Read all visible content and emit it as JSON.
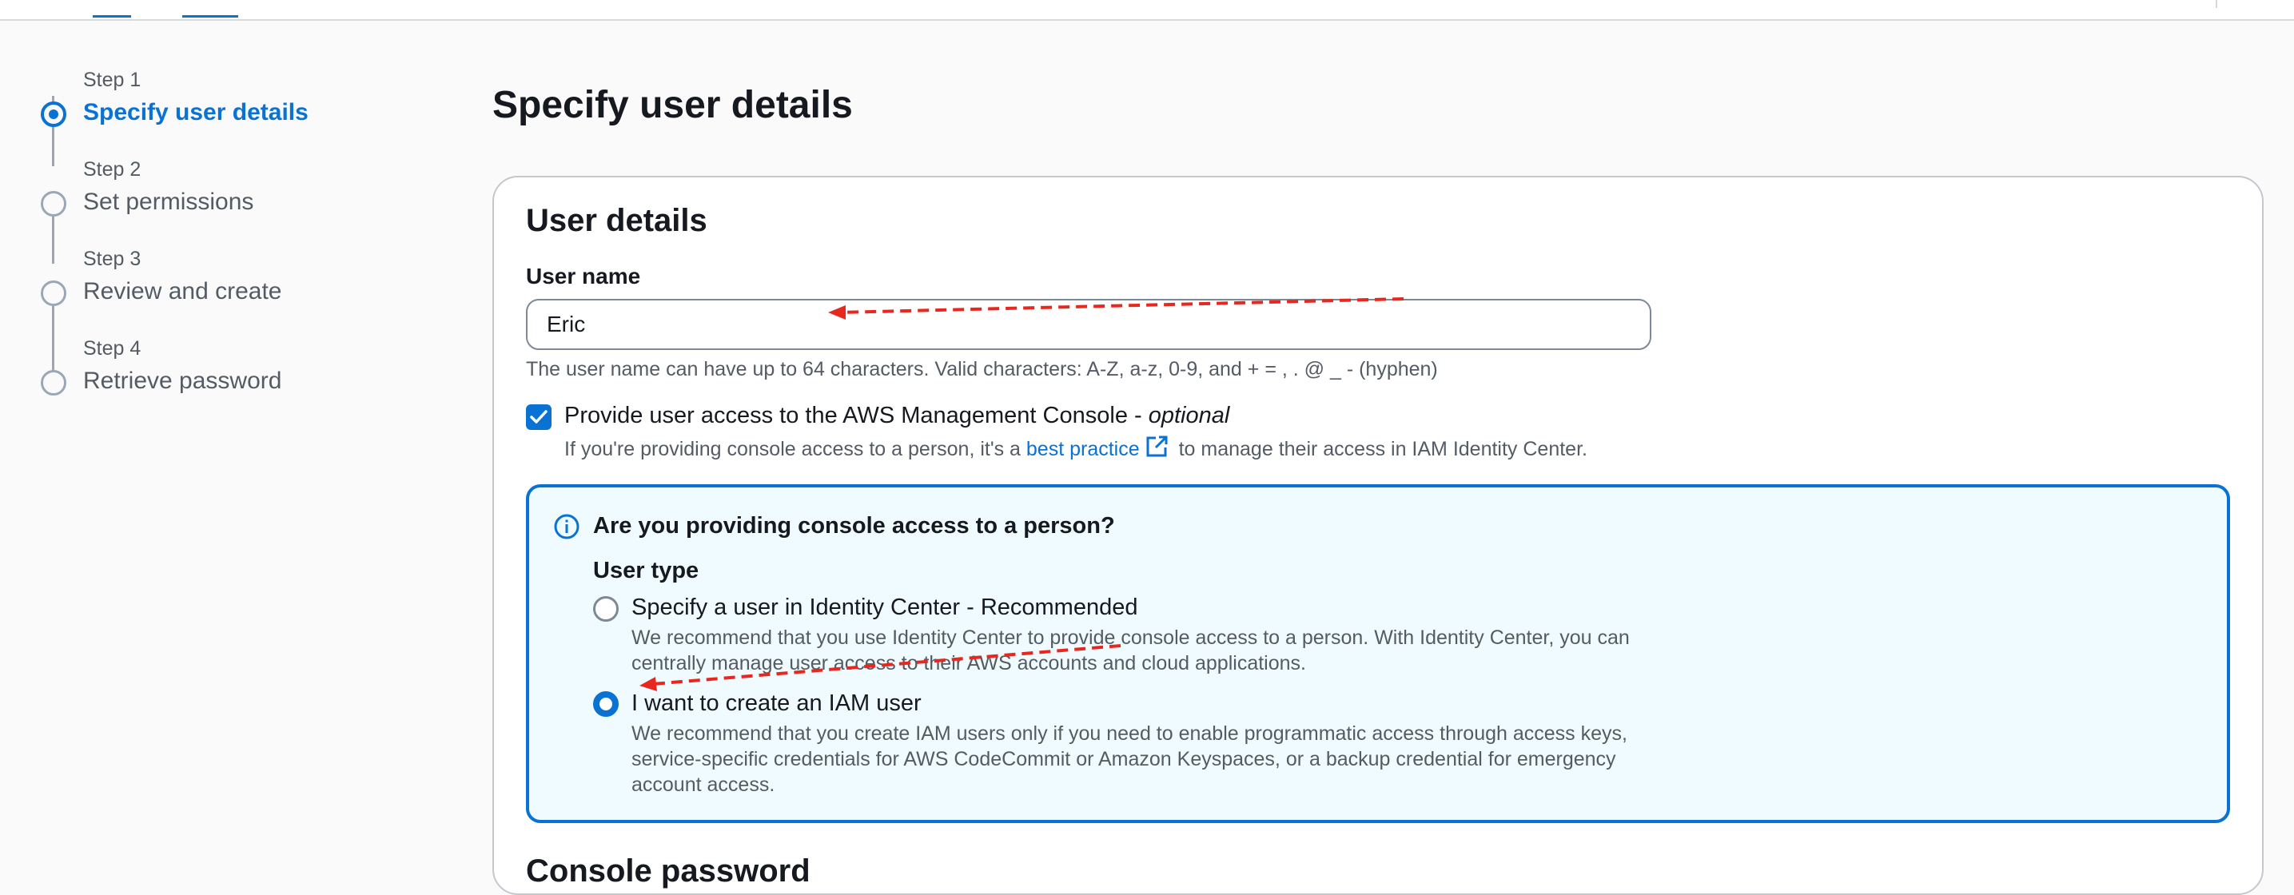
{
  "steps": [
    {
      "kicker": "Step 1",
      "title": "Specify user details",
      "active": true
    },
    {
      "kicker": "Step 2",
      "title": "Set permissions",
      "active": false
    },
    {
      "kicker": "Step 3",
      "title": "Review and create",
      "active": false
    },
    {
      "kicker": "Step 4",
      "title": "Retrieve password",
      "active": false
    }
  ],
  "page": {
    "title": "Specify user details"
  },
  "user_details": {
    "section_title": "User details",
    "user_name_label": "User name",
    "user_name_value": "Eric",
    "user_name_constraint": "The user name can have up to 64 characters. Valid characters: A-Z, a-z, 0-9, and + = , . @ _ - (hyphen)",
    "console_access": {
      "checked": true,
      "label": "Provide user access to the AWS Management Console - ",
      "label_optional": "optional",
      "desc_before": "If you're providing console access to a person, it's a ",
      "desc_link": "best practice",
      "desc_after": " to manage their access in IAM Identity Center."
    }
  },
  "alert": {
    "heading": "Are you providing console access to a person?",
    "group_label": "User type",
    "options": [
      {
        "label": "Specify a user in Identity Center - Recommended",
        "description": "We recommend that you use Identity Center to provide console access to a person. With Identity Center, you can centrally manage user access to their AWS accounts and cloud applications.",
        "selected": false
      },
      {
        "label": "I want to create an IAM user",
        "description": "We recommend that you create IAM users only if you need to enable programmatic access through access keys, service-specific credentials for AWS CodeCommit or Amazon Keyspaces, or a backup credential for emergency account access.",
        "selected": true
      }
    ]
  },
  "next_section_heading": "Console password",
  "colors": {
    "accent": "#0972d3",
    "annotation_arrow": "#e8281f",
    "alert_bg": "#f0fbff"
  },
  "icons": [
    "info-icon",
    "external-link-icon",
    "checkmark-icon"
  ]
}
